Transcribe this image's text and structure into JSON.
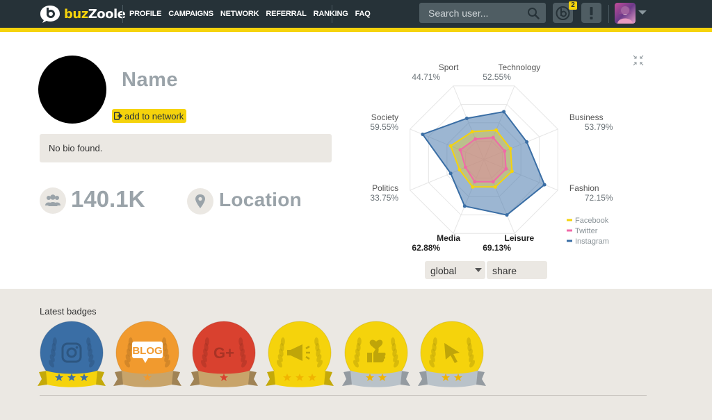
{
  "brand": {
    "name_part1": "buz",
    "name_part2": "Zoole"
  },
  "nav": [
    "PROFILE",
    "CAMPAIGNS",
    "NETWORK",
    "REFERRAL",
    "RANKING",
    "FAQ"
  ],
  "search": {
    "placeholder": "Search user..."
  },
  "header": {
    "notification_count": "2",
    "alert_label": "!"
  },
  "profile": {
    "name": "Name",
    "add_to_network": "add to network",
    "bio": "No bio found.",
    "followers": "140.1K",
    "location": "Location"
  },
  "radar": {
    "axes": [
      {
        "label": "Sport",
        "value": "44.71%"
      },
      {
        "label": "Technology",
        "value": "52.55%"
      },
      {
        "label": "Business",
        "value": "53.79%"
      },
      {
        "label": "Fashion",
        "value": "72.15%"
      },
      {
        "label": "Leisure",
        "value": "69.13%"
      },
      {
        "label": "Media",
        "value": "62.88%"
      },
      {
        "label": "Politics",
        "value": "33.75%"
      },
      {
        "label": "Society",
        "value": "59.55%"
      }
    ],
    "series": [
      {
        "name": "Facebook",
        "color": "#f5d30c",
        "values": [
          0.38,
          0.4,
          0.36,
          0.38,
          0.37,
          0.37,
          0.33,
          0.45
        ]
      },
      {
        "name": "Twitter",
        "color": "#f06aa8",
        "values": [
          0.28,
          0.3,
          0.28,
          0.3,
          0.3,
          0.3,
          0.25,
          0.32
        ]
      },
      {
        "name": "Instagram",
        "color": "#3a6ea5",
        "values": [
          0.56,
          0.65,
          0.58,
          0.82,
          0.75,
          0.63,
          0.45,
          0.83
        ]
      }
    ]
  },
  "filters": {
    "scope": "global",
    "metric": "share"
  },
  "badges": {
    "title": "Latest badges",
    "items": [
      {
        "icon": "instagram-icon",
        "color": "#3a6ea5",
        "ribbon": "#f5d30c",
        "stars": 3,
        "star_color": "#3a6ea5",
        "text": ""
      },
      {
        "icon": "blog-icon",
        "color": "#f19a2e",
        "ribbon": "#c8a46a",
        "stars": 1,
        "star_color": "#f19a2e",
        "text": "BLOG"
      },
      {
        "icon": "google-plus-icon",
        "color": "#d9412f",
        "ribbon": "#c8a46a",
        "stars": 1,
        "star_color": "#d9412f",
        "text": "G+"
      },
      {
        "icon": "megaphone-icon",
        "color": "#f5d30c",
        "ribbon": "#f5d30c",
        "stars": 3,
        "star_color": "#f5d30c",
        "text": ""
      },
      {
        "icon": "like-icon",
        "color": "#f5d30c",
        "ribbon": "#b9c2c9",
        "stars": 2,
        "star_color": "#f5d30c",
        "text": ""
      },
      {
        "icon": "cursor-icon",
        "color": "#f5d30c",
        "ribbon": "#b9c2c9",
        "stars": 2,
        "star_color": "#f5d30c",
        "text": ""
      }
    ]
  }
}
